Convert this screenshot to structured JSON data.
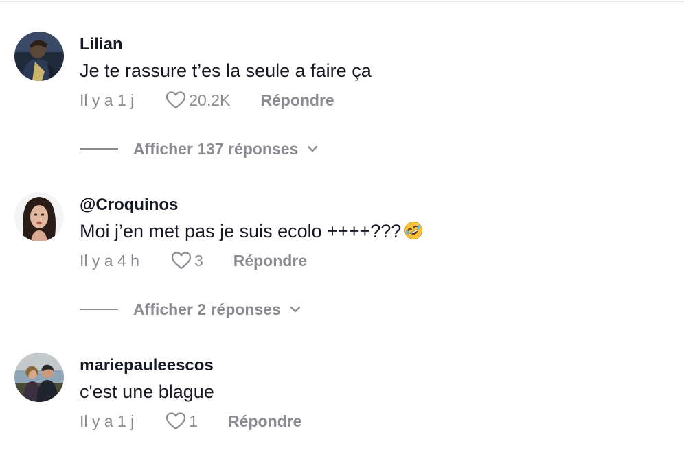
{
  "comments": [
    {
      "username": "Lilian",
      "text": "Je te rassure t’es la seule a faire ça",
      "time": "Il y a 1 j",
      "likes": "20.2K",
      "reply_label": "Répondre",
      "view_replies": "Afficher 137 réponses"
    },
    {
      "username": "@Croquinos",
      "text": "Moi j’en met pas je suis ecolo ++++???",
      "time": "Il y a 4 h",
      "likes": "3",
      "reply_label": "Répondre",
      "view_replies": "Afficher 2 réponses",
      "emoji": "rolling-on-floor-laughing-emoji"
    },
    {
      "username": "mariepauleescos",
      "text": "c'est une blague",
      "time": "Il y a 1 j",
      "likes": "1",
      "reply_label": "Répondre"
    }
  ],
  "icons": {
    "like": "heart-outline-icon",
    "expand": "chevron-down-icon"
  },
  "colors": {
    "text": "#161823",
    "secondary": "#8a8b91",
    "divider": "#e5e5e5"
  }
}
